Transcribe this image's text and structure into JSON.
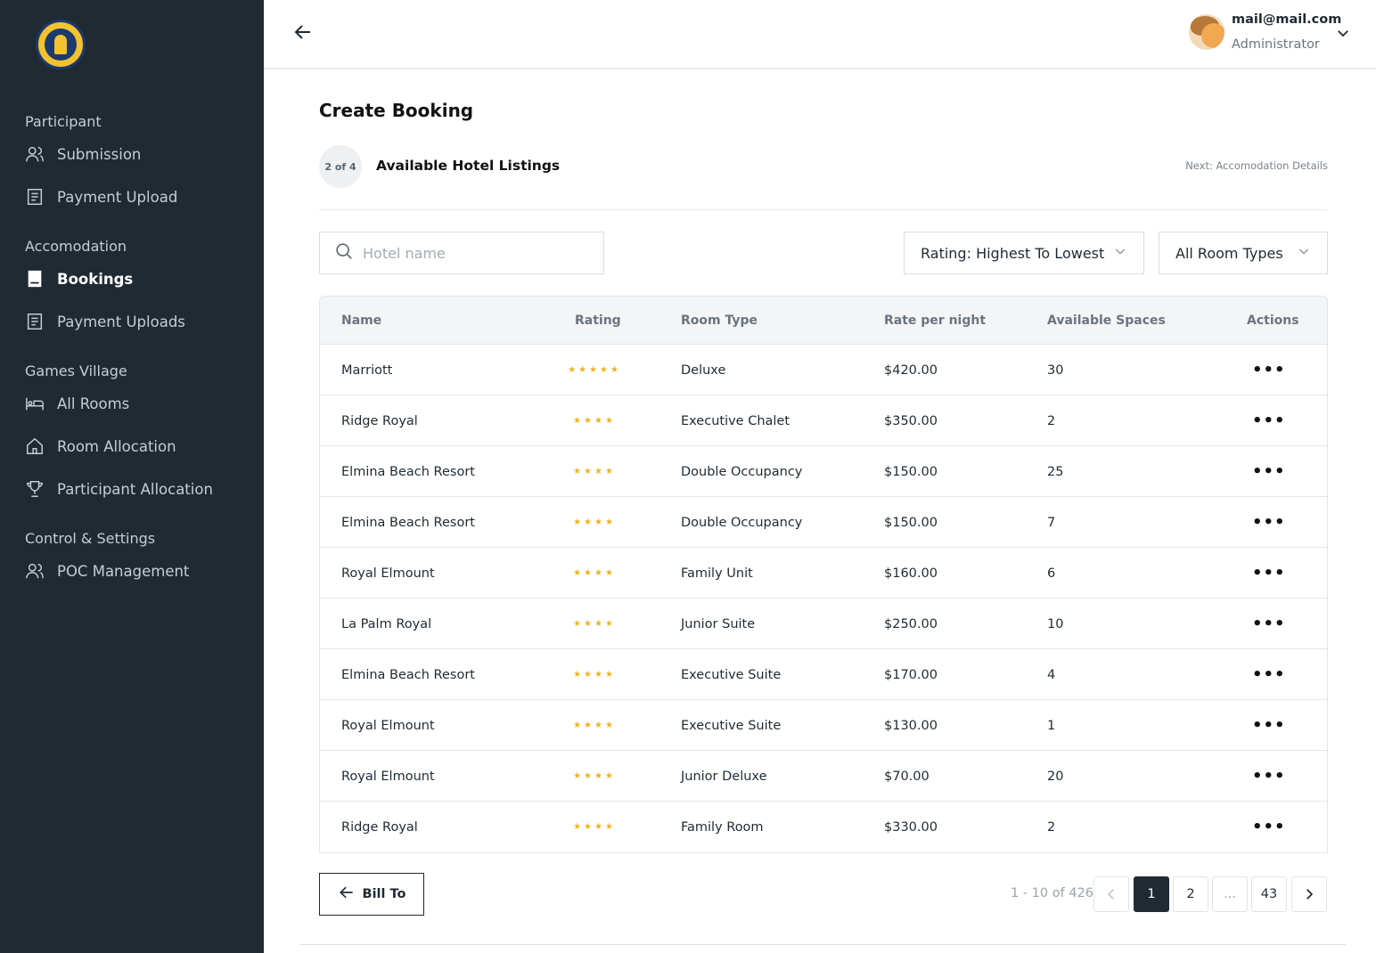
{
  "sidebar": {
    "sections": [
      {
        "label": "Participant"
      },
      {
        "label": "Accomodation"
      },
      {
        "label": "Games Village"
      },
      {
        "label": "Control & Settings"
      }
    ],
    "items": [
      {
        "label": "Submission",
        "icon": "users-icon"
      },
      {
        "label": "Payment Upload",
        "icon": "document-icon"
      },
      {
        "label": "Bookings",
        "icon": "book-icon",
        "active": true
      },
      {
        "label": "Payment Uploads",
        "icon": "document-icon"
      },
      {
        "label": "All Rooms",
        "icon": "bed-icon"
      },
      {
        "label": "Room Allocation",
        "icon": "home-icon"
      },
      {
        "label": "Participant Allocation",
        "icon": "trophy-icon"
      },
      {
        "label": "POC Management",
        "icon": "users-icon"
      }
    ]
  },
  "header": {
    "email": "mail@mail.com",
    "role": "Administrator"
  },
  "main": {
    "title": "Create Booking",
    "step": "2 of 4",
    "step_title": "Available Hotel Listings",
    "next_step": "Next: Accomodation Details",
    "search_placeholder": "Hotel name",
    "sort_select": "Rating: Highest To Lowest",
    "room_type_select": "All Room Types"
  },
  "table": {
    "columns": [
      "Name",
      "Rating",
      "Room Type",
      "Rate per night",
      "Available Spaces",
      "Actions"
    ],
    "rows": [
      {
        "name": "Marriott",
        "rating": 5,
        "room_type": "Deluxe",
        "rate": "$420.00",
        "spaces": "30"
      },
      {
        "name": "Ridge Royal",
        "rating": 4,
        "room_type": "Executive Chalet",
        "rate": "$350.00",
        "spaces": "2"
      },
      {
        "name": "Elmina Beach Resort",
        "rating": 4,
        "room_type": "Double Occupancy",
        "rate": "$150.00",
        "spaces": "25"
      },
      {
        "name": "Elmina Beach Resort",
        "rating": 4,
        "room_type": "Double Occupancy",
        "rate": "$150.00",
        "spaces": "7"
      },
      {
        "name": "Royal Elmount",
        "rating": 4,
        "room_type": "Family Unit",
        "rate": "$160.00",
        "spaces": "6"
      },
      {
        "name": "La Palm Royal",
        "rating": 4,
        "room_type": "Junior Suite",
        "rate": "$250.00",
        "spaces": "10"
      },
      {
        "name": "Elmina Beach Resort",
        "rating": 4,
        "room_type": "Executive Suite",
        "rate": "$170.00",
        "spaces": "4"
      },
      {
        "name": "Royal Elmount",
        "rating": 4,
        "room_type": "Executive Suite",
        "rate": "$130.00",
        "spaces": "1"
      },
      {
        "name": "Royal Elmount",
        "rating": 4,
        "room_type": "Junior Deluxe",
        "rate": "$70.00",
        "spaces": "20"
      },
      {
        "name": "Ridge Royal",
        "rating": 4,
        "room_type": "Family Room",
        "rate": "$330.00",
        "spaces": "2"
      }
    ]
  },
  "footer": {
    "bill_to_label": "Bill To",
    "range": "1 - 10 of 426",
    "pages": [
      "1",
      "2",
      "...",
      "43"
    ],
    "current_page": "1"
  },
  "colors": {
    "sidebar_bg": "#1f2a33",
    "accent_dark": "#1f2a33",
    "star": "#f2b21c"
  }
}
